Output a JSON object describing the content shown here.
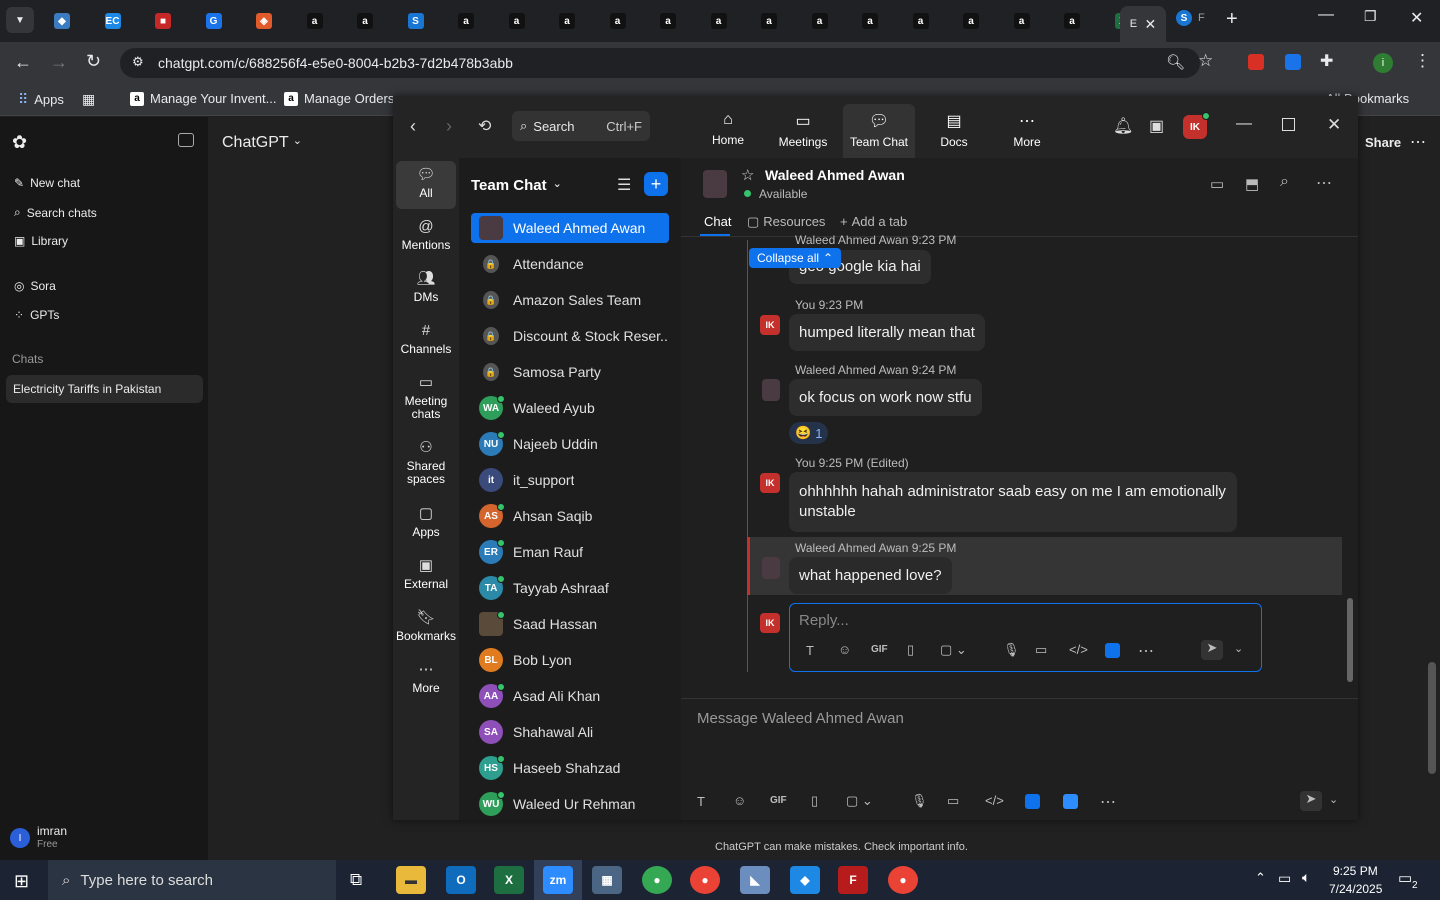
{
  "chrome": {
    "url": "chatgpt.com/c/688256f4-e5e0-8004-b2b3-7d2b478b3abb",
    "tabs": [
      {
        "fav": "◆",
        "color": "#3b7bbf"
      },
      {
        "fav": "EC",
        "color": "#1e88e5"
      },
      {
        "fav": "■",
        "color": "#c62828"
      },
      {
        "fav": "G",
        "color": "#1a73e8"
      },
      {
        "fav": "◈",
        "color": "#e05a2b"
      },
      {
        "fav": "a",
        "color": "#111111"
      },
      {
        "fav": "a",
        "color": "#111111"
      },
      {
        "fav": "S",
        "color": "#1976d2"
      },
      {
        "fav": "a",
        "color": "#111111"
      },
      {
        "fav": "a",
        "color": "#111111"
      },
      {
        "fav": "a",
        "color": "#111111"
      },
      {
        "fav": "a",
        "color": "#111111"
      },
      {
        "fav": "a",
        "color": "#111111"
      },
      {
        "fav": "a",
        "color": "#111111"
      },
      {
        "fav": "a",
        "color": "#111111"
      },
      {
        "fav": "a",
        "color": "#111111"
      },
      {
        "fav": "a",
        "color": "#111111"
      },
      {
        "fav": "a",
        "color": "#111111"
      },
      {
        "fav": "a",
        "color": "#111111"
      },
      {
        "fav": "a",
        "color": "#111111"
      },
      {
        "fav": "a",
        "color": "#111111"
      },
      {
        "fav": "X",
        "color": "#1d6f42"
      }
    ],
    "active_tab_label": "E",
    "last_tab_label": "F",
    "bookmarks": {
      "apps": "Apps",
      "item1": "Manage Your Invent...",
      "item2": "Manage Orders",
      "all": "All Bookmarks"
    }
  },
  "gpt": {
    "title": "ChatGPT",
    "new_chat": "New chat",
    "search": "Search chats",
    "library": "Library",
    "sora": "Sora",
    "gpts": "GPTs",
    "chats_heading": "Chats",
    "chat_item": "Electricity Tariffs in Pakistan",
    "user_name": "imran",
    "user_plan": "Free",
    "share": "Share",
    "disclaimer": "ChatGPT can make mistakes. Check important info."
  },
  "zoom": {
    "search_label": "Search",
    "search_shortcut": "Ctrl+F",
    "nav": [
      "Home",
      "Meetings",
      "Team Chat",
      "Docs",
      "More"
    ],
    "profile_initials": "IK",
    "rail": [
      "All",
      "Mentions",
      "DMs",
      "Channels",
      "Meeting chats",
      "Shared spaces",
      "Apps",
      "External",
      "Bookmarks",
      "More"
    ],
    "list_title": "Team Chat",
    "contacts": [
      {
        "name": "Waleed Ahmed Awan",
        "initials": "",
        "color": "#4a3a42",
        "type": "photo",
        "selected": true
      },
      {
        "name": "Attendance",
        "initials": "🔒",
        "color": "#555555",
        "type": "lock"
      },
      {
        "name": "Amazon Sales Team",
        "initials": "🔒",
        "color": "#555555",
        "type": "lock"
      },
      {
        "name": "Discount & Stock Reser...",
        "initials": "🔒",
        "color": "#555555",
        "type": "lock"
      },
      {
        "name": "Samosa Party",
        "initials": "🔒",
        "color": "#555555",
        "type": "lock"
      },
      {
        "name": "Waleed Ayub",
        "initials": "WA",
        "color": "#2e9e5b",
        "type": "user",
        "online": true
      },
      {
        "name": "Najeeb Uddin",
        "initials": "NU",
        "color": "#2b7bb9",
        "type": "user",
        "online": true
      },
      {
        "name": "it_support",
        "initials": "it",
        "color": "#3a4a7a",
        "type": "user",
        "online": false
      },
      {
        "name": "Ahsan Saqib",
        "initials": "AS",
        "color": "#d4652c",
        "type": "user",
        "online": true
      },
      {
        "name": "Eman Rauf",
        "initials": "ER",
        "color": "#2b7bb9",
        "type": "user",
        "online": true
      },
      {
        "name": "Tayyab Ashraaf",
        "initials": "TA",
        "color": "#2b8aa8",
        "type": "user",
        "online": true
      },
      {
        "name": "Saad Hassan",
        "initials": "",
        "color": "#5a4a3a",
        "type": "photo",
        "online": true
      },
      {
        "name": "Bob Lyon",
        "initials": "BL",
        "color": "#e07b1f",
        "type": "user",
        "online": false
      },
      {
        "name": "Asad Ali Khan",
        "initials": "AA",
        "color": "#8e4fb8",
        "type": "user",
        "online": true
      },
      {
        "name": "Shahawal Ali",
        "initials": "SA",
        "color": "#8e4fb8",
        "type": "user",
        "online": false
      },
      {
        "name": "Haseeb Shahzad",
        "initials": "HS",
        "color": "#2e9e8f",
        "type": "user",
        "online": true
      },
      {
        "name": "Waleed Ur Rehman",
        "initials": "WU",
        "color": "#2e9e5b",
        "type": "user",
        "online": true
      }
    ],
    "chat": {
      "contact_name": "Waleed Ahmed Awan",
      "status": "Available",
      "tab_chat": "Chat",
      "tab_resources": "Resources",
      "tab_add": "Add a tab",
      "collapse": "Collapse all",
      "top_header": "Waleed Ahmed Awan 9:23 PM",
      "msg0": "geo google kia hai",
      "h1": "You 9:23 PM",
      "msg1": "humped literally mean that",
      "h2": "Waleed Ahmed Awan 9:24 PM",
      "msg2": "ok focus on work now stfu",
      "reaction": "😆",
      "reaction_count": "1",
      "h3": "You 9:25 PM (Edited)",
      "msg3": "ohhhhhh hahah administrator saab easy on me I am emotionally unstable",
      "h4": "Waleed Ahmed Awan 9:25 PM",
      "msg4": "what happened love?",
      "reply_placeholder": "Reply...",
      "message_placeholder": "Message Waleed Ahmed Awan"
    }
  },
  "taskbar": {
    "search_placeholder": "Type here to search",
    "time": "9:25 PM",
    "date": "7/24/2025",
    "notif_count": "2"
  }
}
